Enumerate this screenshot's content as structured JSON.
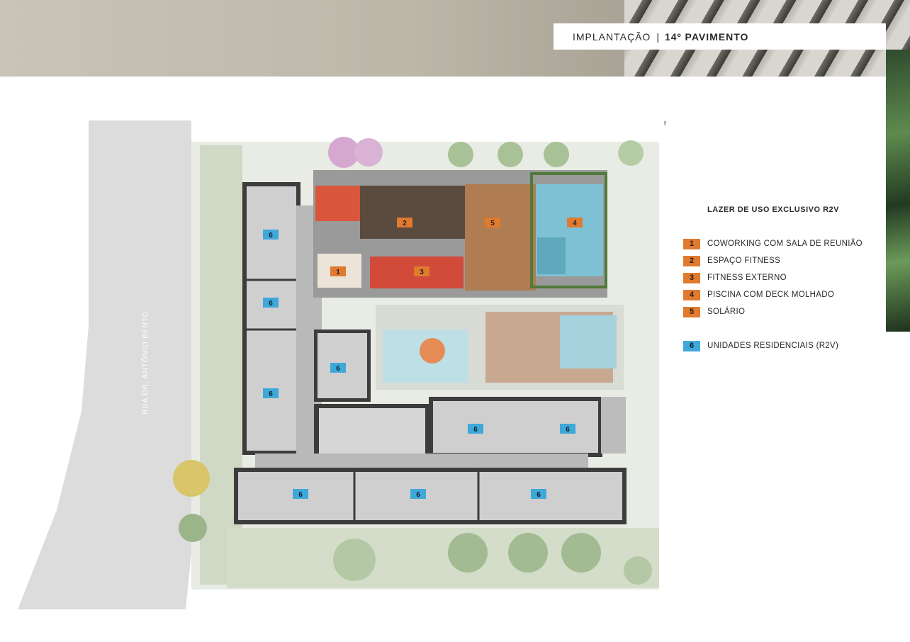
{
  "header": {
    "label": "IMPLANTAÇÃO",
    "separator": "|",
    "floor": "14º PAVIMENTO"
  },
  "street_name": "RUA DR. ANTÔNIO BENTO",
  "north_mark": "N",
  "legend": {
    "title": "LAZER DE USO EXCLUSIVO R2V",
    "items": [
      {
        "num": "1",
        "label": "COWORKING COM SALA DE REUNIÃO",
        "color": "#e07a2e"
      },
      {
        "num": "2",
        "label": "ESPAÇO FITNESS",
        "color": "#e07a2e"
      },
      {
        "num": "3",
        "label": "FITNESS EXTERNO",
        "color": "#e07a2e"
      },
      {
        "num": "4",
        "label": "PISCINA COM DECK MOLHADO",
        "color": "#e07a2e"
      },
      {
        "num": "5",
        "label": "SOLÁRIO",
        "color": "#e07a2e"
      }
    ],
    "residential": {
      "num": "6",
      "label": "UNIDADES RESIDENCIAIS (R2V)",
      "color": "#3ea8d8"
    }
  },
  "plan_markers": {
    "m1": "1",
    "m2": "2",
    "m3": "3",
    "m4": "4",
    "m5": "5",
    "u1": "6",
    "u2": "6",
    "u3": "6",
    "u4": "6",
    "u5": "6",
    "u6": "6",
    "u7": "6",
    "u8": "6",
    "u9": "6"
  }
}
